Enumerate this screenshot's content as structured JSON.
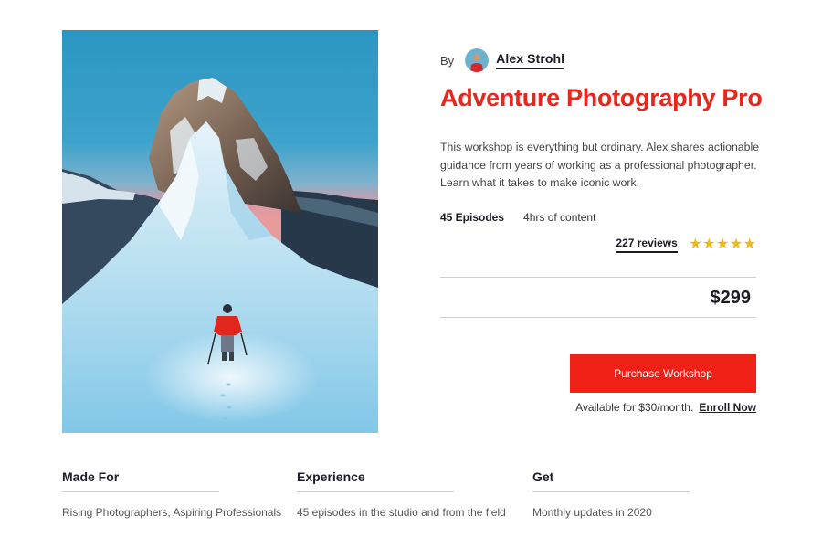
{
  "byline": {
    "prefix": "By",
    "author": "Alex Strohl"
  },
  "product": {
    "title": "Adventure Photography Pro",
    "description": "This workshop is everything but ordinary. Alex shares actionable guidance from years of working as a professional photographer. Learn what it takes to make iconic work.",
    "episodes": "45 Episodes",
    "duration": "4hrs of content",
    "reviews": "227 reviews",
    "rating": 5,
    "rating_max": 5,
    "price": "$299"
  },
  "purchase": {
    "button_label": "Purchase Workshop",
    "monthly_text": "Available for $30/month.",
    "enroll_label": "Enroll Now"
  },
  "features": [
    {
      "heading": "Made For",
      "text": "Rising Photographers, Aspiring Professionals"
    },
    {
      "heading": "Experience",
      "text": "45 episodes in the studio and from the field"
    },
    {
      "heading": "Get",
      "text": "Monthly updates in 2020"
    }
  ],
  "colors": {
    "accent": "#e8261d",
    "button": "#ef2117",
    "star": "#f3b619",
    "text": "#1c1c28"
  },
  "icons": {
    "star": "star-icon",
    "avatar": "author-avatar"
  }
}
